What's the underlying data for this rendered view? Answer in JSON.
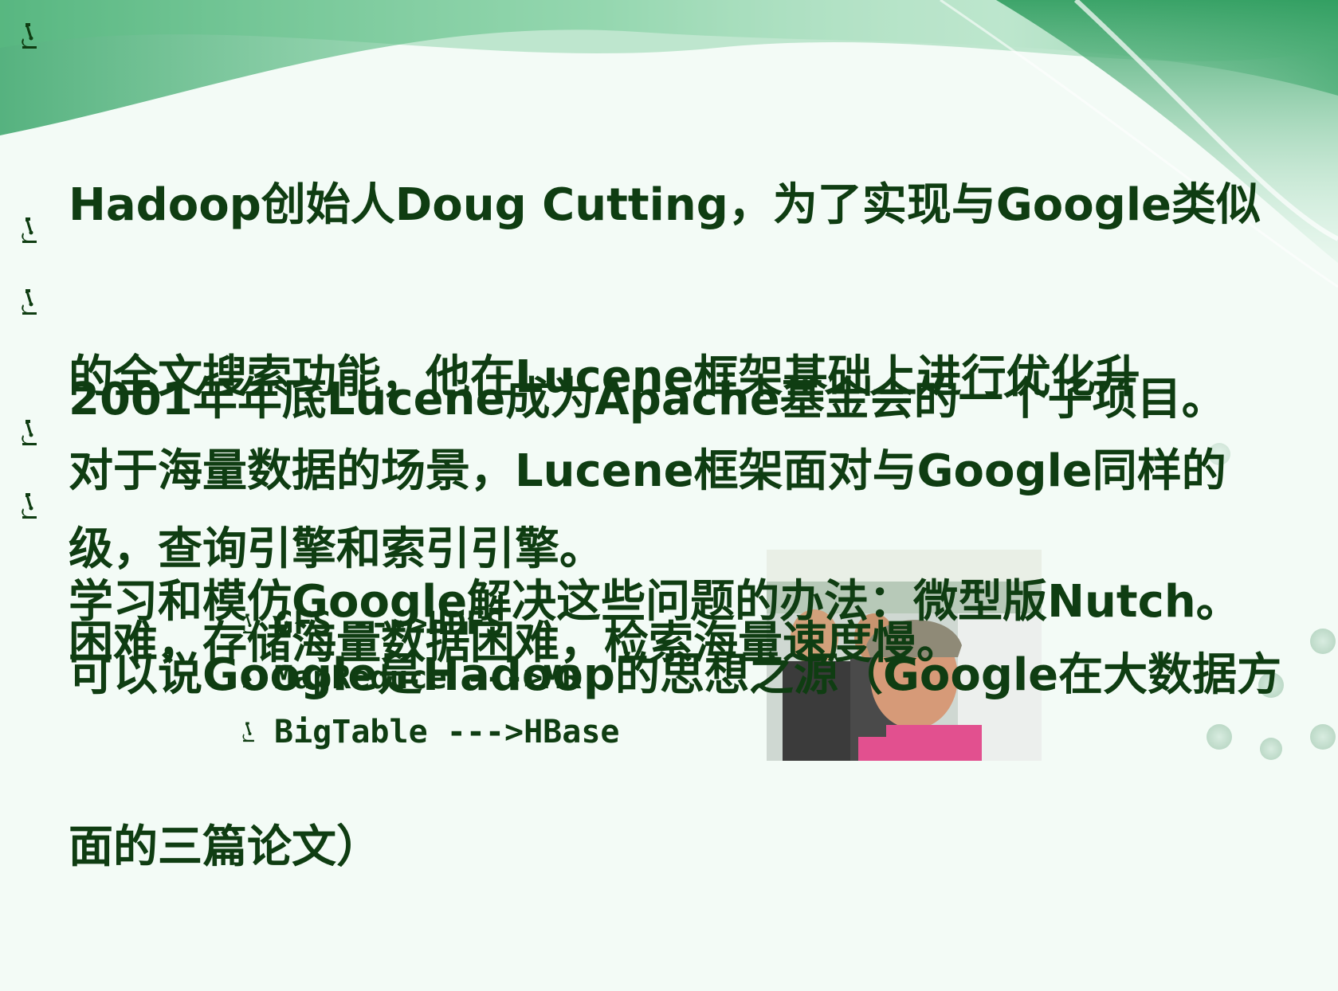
{
  "slide": {
    "bullets": [
      {
        "lines": [
          "Hadoop创始人Doug Cutting，为了实现与Google类似",
          "的全文搜索功能，他在Lucene框架基础上进行优化升",
          "级，查询引擎和索引引擎。"
        ]
      },
      {
        "lines": [
          "2001年年底Lucene成为Apache基金会的一个子项目。"
        ]
      },
      {
        "lines": [
          "对于海量数据的场景，Lucene框架面对与Google同样的",
          "困难，存储海量数据困难，检索海量速度慢。"
        ]
      },
      {
        "lines": [
          "学习和模仿Google解决这些问题的办法：微型版Nutch。"
        ]
      },
      {
        "lines": [
          "可以说Google是Hadoop的思想之源（Google在大数据方",
          "面的三篇论文）"
        ]
      }
    ],
    "sub_bullets": [
      "GFS --->HDFS",
      "MapReduce --->MR",
      "BigTable --->HBase"
    ]
  },
  "colors": {
    "text": "#0f3d12",
    "accent_green": "#3aa56a",
    "background": "#f3fbf6"
  },
  "icons": {
    "bullet": "microscope-icon"
  }
}
